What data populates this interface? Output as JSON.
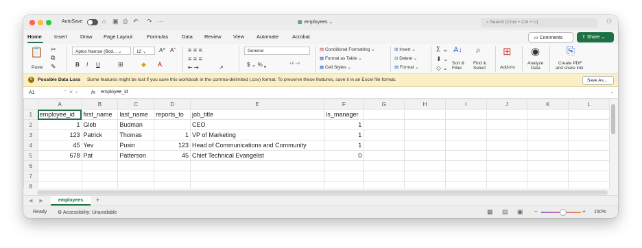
{
  "titlebar": {
    "autosave_label": "AutoSave",
    "doc_title": "employees",
    "search_placeholder": "Search (Cmd + Ctrl + U)"
  },
  "ribbon_tabs": [
    "Home",
    "Insert",
    "Draw",
    "Page Layout",
    "Formulas",
    "Data",
    "Review",
    "View",
    "Automate",
    "Acrobat"
  ],
  "ribbon_buttons": {
    "comments": "Comments",
    "share": "Share"
  },
  "ribbon": {
    "paste": "Paste",
    "font_name": "Aptos Narrow (Bod...",
    "font_size": "12",
    "number_format": "General",
    "conditional_formatting": "Conditional Formatting",
    "format_as_table": "Format as Table",
    "cell_styles": "Cell Styles",
    "insert": "Insert",
    "delete": "Delete",
    "format": "Format",
    "sort_filter_1": "Sort &",
    "sort_filter_2": "Filter",
    "find_select_1": "Find &",
    "find_select_2": "Select",
    "addins": "Add-ins",
    "analyze_1": "Analyze",
    "analyze_2": "Data",
    "create_pdf_1": "Create PDF",
    "create_pdf_2": "and share link"
  },
  "infobar": {
    "title": "Possible Data Loss",
    "message": "Some features might be lost if you save this workbook in the comma-delimited (.csv) format. To preserve these features, save it in an Excel file format.",
    "save_as": "Save As..."
  },
  "formula_bar": {
    "name_box": "A1",
    "fx": "fx",
    "formula": "employee_id"
  },
  "grid": {
    "columns": [
      "A",
      "B",
      "C",
      "D",
      "E",
      "F",
      "G",
      "H",
      "I",
      "J",
      "K",
      "L"
    ],
    "rows": [
      {
        "n": "1",
        "cells": [
          "employee_id",
          "first_name",
          "last_name",
          "reports_to",
          "job_title",
          "is_manager",
          "",
          "",
          "",
          "",
          "",
          ""
        ]
      },
      {
        "n": "2",
        "cells": [
          "1",
          "Gleb",
          "Budman",
          "",
          "CEO",
          "1",
          "",
          "",
          "",
          "",
          "",
          ""
        ]
      },
      {
        "n": "3",
        "cells": [
          "123",
          "Patrick",
          "Thomas",
          "1",
          "VP of Marketing",
          "1",
          "",
          "",
          "",
          "",
          "",
          ""
        ]
      },
      {
        "n": "4",
        "cells": [
          "45",
          "Yev",
          "Pusin",
          "123",
          "Head of Communications and Community",
          "1",
          "",
          "",
          "",
          "",
          "",
          ""
        ]
      },
      {
        "n": "5",
        "cells": [
          "678",
          "Pat",
          "Patterson",
          "45",
          "Chief Technical Evangelist",
          "0",
          "",
          "",
          "",
          "",
          "",
          ""
        ]
      },
      {
        "n": "6",
        "cells": [
          "",
          "",
          "",
          "",
          "",
          "",
          "",
          "",
          "",
          "",
          "",
          ""
        ]
      },
      {
        "n": "7",
        "cells": [
          "",
          "",
          "",
          "",
          "",
          "",
          "",
          "",
          "",
          "",
          "",
          ""
        ]
      },
      {
        "n": "8",
        "cells": [
          "",
          "",
          "",
          "",
          "",
          "",
          "",
          "",
          "",
          "",
          "",
          ""
        ]
      }
    ]
  },
  "sheets": [
    "employees"
  ],
  "status": {
    "ready": "Ready",
    "accessibility": "Accessibility: Unavailable",
    "zoom": "150%"
  },
  "colors": {
    "accent": "#1e7145",
    "infobar_bg": "#fbefc8"
  }
}
